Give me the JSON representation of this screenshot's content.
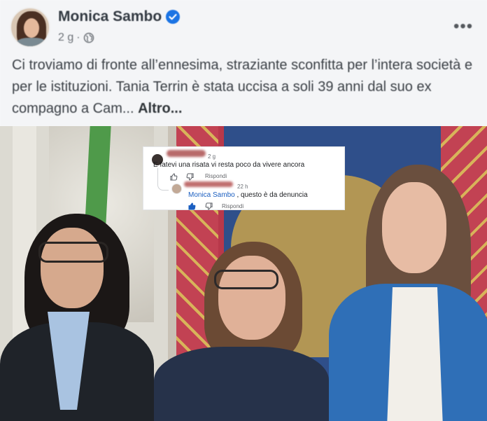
{
  "post": {
    "author": "Monica Sambo",
    "time": "2 g",
    "separator": "·",
    "text": "Ci troviamo di fronte all’ennesima, straziante sconfitta per l’intera società e per le istituzioni. Tania Terrin è stata uccisa a soli 39 anni dal suo ex compagno a Cam...",
    "more_label": "Altro...",
    "more_menu": "•••"
  },
  "overlay": {
    "comment1": {
      "time": "2 g",
      "text": "E fatevi una risata vi resta poco da vivere ancora",
      "reply_label": "Rispondi"
    },
    "comment2": {
      "time": "22 h",
      "mention": "Monica Sambo",
      "text": " , questo è da denuncia",
      "reply_label": "Rispondi"
    }
  },
  "colors": {
    "verified": "#1b74e4",
    "mention": "#1b5fc1"
  },
  "icons": [
    "verified-icon",
    "globe-icon",
    "more-icon",
    "like-icon",
    "dislike-icon"
  ]
}
